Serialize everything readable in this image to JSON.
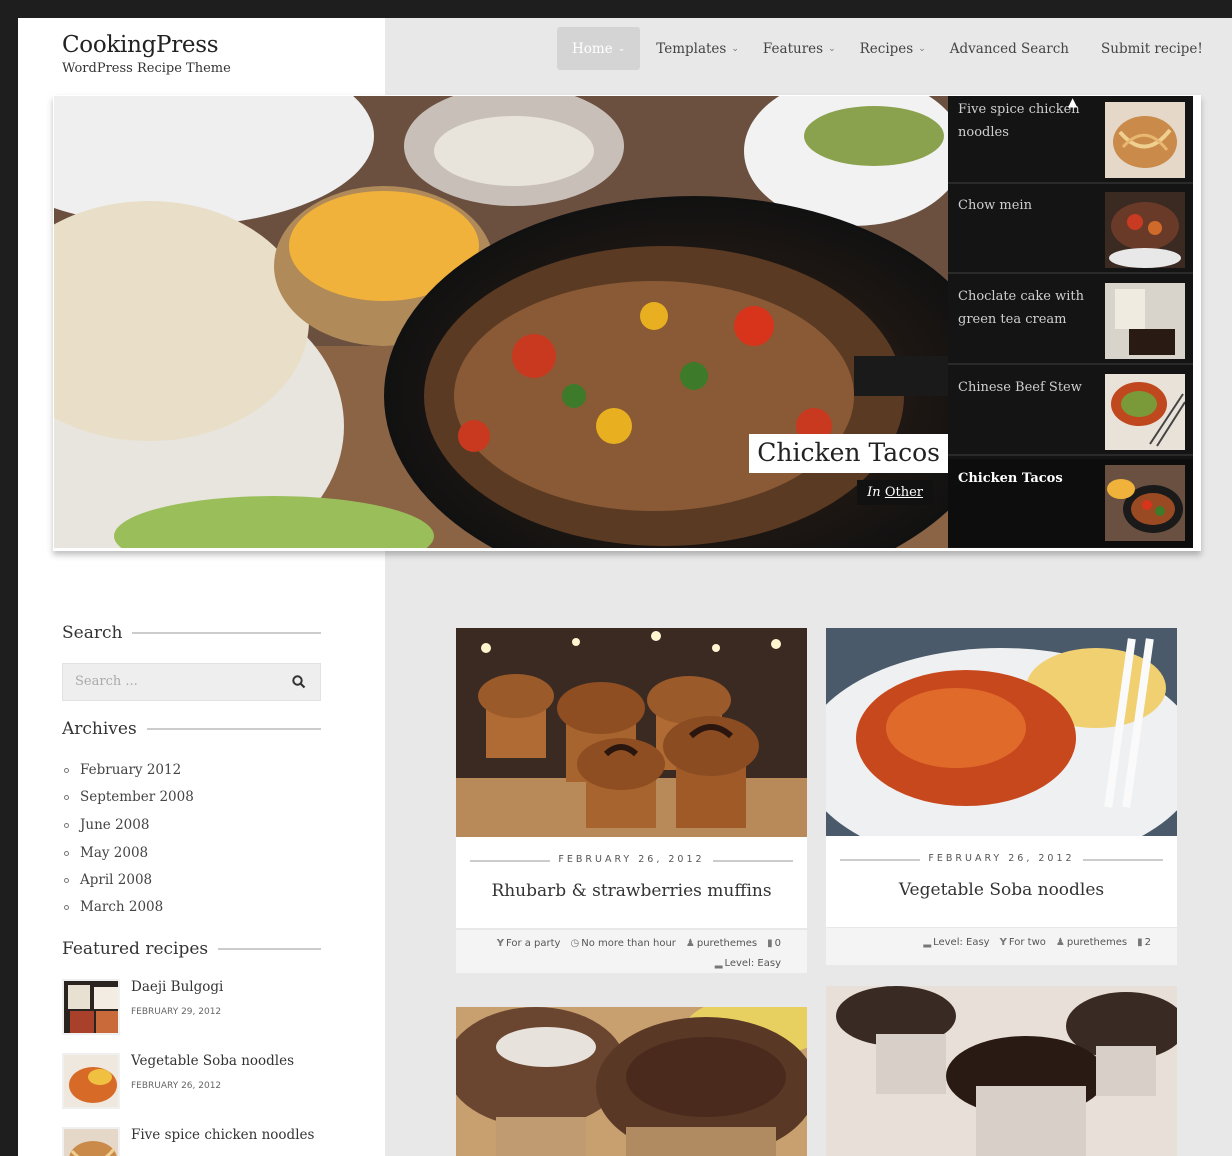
{
  "site": {
    "title": "CookingPress",
    "tagline": "WordPress Recipe Theme"
  },
  "nav": [
    {
      "label": "Home",
      "dropdown": true,
      "active": true
    },
    {
      "label": "Templates",
      "dropdown": true
    },
    {
      "label": "Features",
      "dropdown": true
    },
    {
      "label": "Recipes",
      "dropdown": true
    },
    {
      "label": "Advanced Search",
      "dropdown": false
    },
    {
      "label": "Submit recipe!",
      "dropdown": false
    }
  ],
  "slider": {
    "caption": "Chicken Tacos",
    "category_prefix": "In",
    "category": "Other",
    "thumbs": [
      {
        "label": "Five spice chicken noodles"
      },
      {
        "label": "Chow mein"
      },
      {
        "label": "Choclate cake with green tea cream"
      },
      {
        "label": "Chinese Beef Stew"
      },
      {
        "label": "Chicken Tacos",
        "active": true
      }
    ]
  },
  "sidebar": {
    "search": {
      "title": "Search",
      "placeholder": "Search ..."
    },
    "archives": {
      "title": "Archives",
      "items": [
        "February 2012",
        "September 2008",
        "June 2008",
        "May 2008",
        "April 2008",
        "March 2008"
      ]
    },
    "featured": {
      "title": "Featured recipes",
      "items": [
        {
          "title": "Daeji Bulgogi",
          "date": "FEBRUARY 29, 2012"
        },
        {
          "title": "Vegetable Soba noodles",
          "date": "FEBRUARY 26, 2012"
        },
        {
          "title": "Five spice chicken noodles",
          "date": ""
        }
      ]
    }
  },
  "posts": [
    {
      "date": "FEBRUARY 26, 2012",
      "title": "Rhubarb & strawberries muffins",
      "meta": {
        "occasion": "For a party",
        "time": "No more than hour",
        "author": "purethemes",
        "comments": "0",
        "level": "Level: Easy"
      }
    },
    {
      "date": "FEBRUARY 26, 2012",
      "title": "Vegetable Soba noodles",
      "meta": {
        "level": "Level: Easy",
        "serves": "For two",
        "author": "purethemes",
        "comments": "2"
      }
    }
  ],
  "colors": {
    "page_bg": "#e8e8e8",
    "outer_bg": "#1e1e1e",
    "nav_active": "#d4d4d4",
    "thumb_bg": "#141414"
  }
}
